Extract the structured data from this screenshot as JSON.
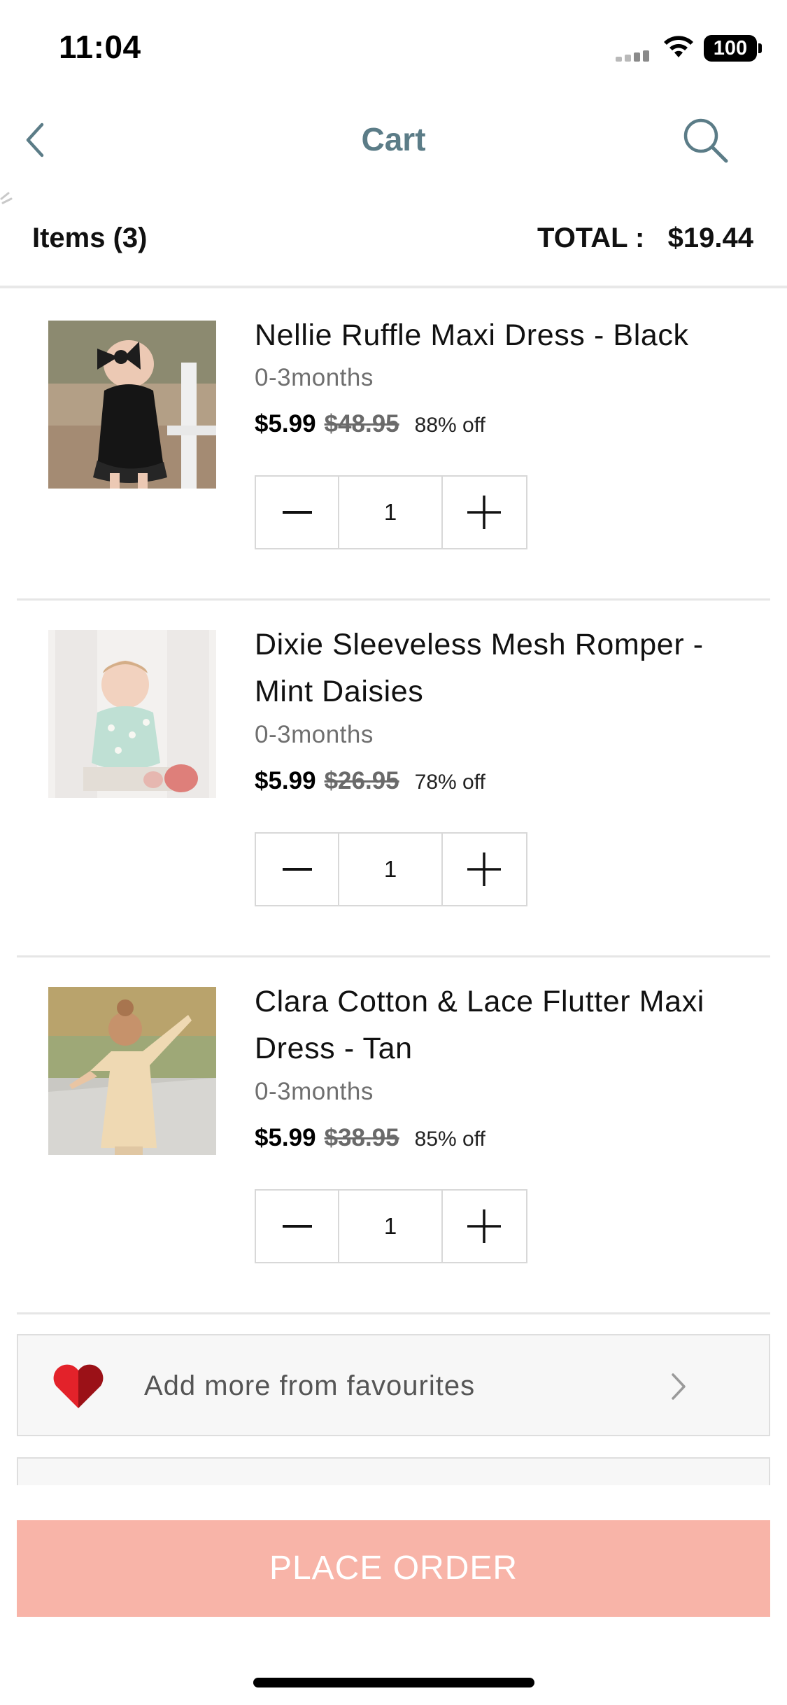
{
  "status_bar": {
    "time": "11:04",
    "battery": "100",
    "icons": [
      "signal-icon",
      "wifi-icon",
      "battery-icon"
    ]
  },
  "nav": {
    "title": "Cart",
    "back_icon": "chevron-left-icon",
    "search_icon": "search-icon"
  },
  "summary": {
    "items_label": "Items   (3)",
    "total_label": "TOTAL :   $19.44"
  },
  "items": [
    {
      "name": "Nellie Ruffle Maxi Dress - Black",
      "size": "0-3months",
      "price": "$5.99",
      "old_price": "$48.95",
      "discount": "88% off",
      "quantity": "1"
    },
    {
      "name": "Dixie Sleeveless Mesh Romper - Mint Daisies",
      "size": "0-3months",
      "price": "$5.99",
      "old_price": "$26.95",
      "discount": "78% off",
      "quantity": "1"
    },
    {
      "name": "Clara Cotton & Lace Flutter Maxi Dress - Tan",
      "size": "0-3months",
      "price": "$5.99",
      "old_price": "$38.95",
      "discount": "85% off",
      "quantity": "1"
    }
  ],
  "favourites": {
    "label": "Add more from favourites",
    "icon": "heart-icon",
    "chevron": "chevron-right-icon"
  },
  "footer": {
    "place_order_label": "PLACE ORDER"
  },
  "colors": {
    "title": "#5b7c87",
    "place_order_bg": "#f8b4a8",
    "heart": "#d81f26"
  }
}
